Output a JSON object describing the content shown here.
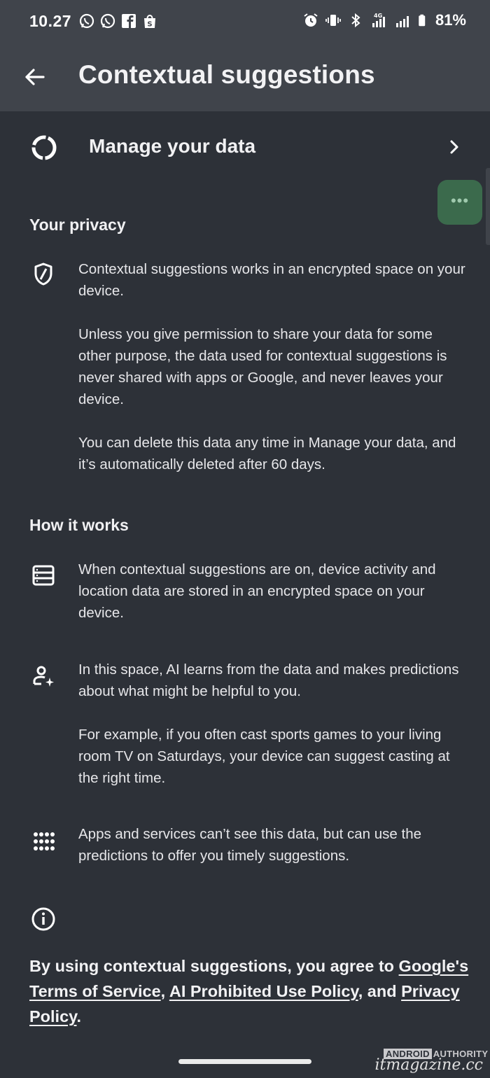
{
  "status_bar": {
    "time": "10.27",
    "battery": "81%",
    "notification_icons": [
      "whatsapp-icon",
      "whatsapp-icon",
      "facebook-icon",
      "shopee-icon"
    ],
    "system_icons": [
      "alarm-icon",
      "vibrate-icon",
      "bluetooth-icon",
      "signal-4g-icon",
      "signal-icon",
      "battery-icon"
    ]
  },
  "app_bar": {
    "title": "Contextual suggestions"
  },
  "manage": {
    "label": "Manage your data"
  },
  "privacy": {
    "heading": "Your privacy",
    "paragraphs": [
      "Contextual suggestions works in an encrypted space on your device.",
      "Unless you give permission to share your data for some other purpose, the data used for contextual suggestions is never shared with apps or Google, and never leaves your device.",
      "You can delete this data any time in Manage your data, and it’s automatically deleted after 60 days."
    ]
  },
  "how": {
    "heading": "How it works",
    "items": [
      {
        "icon": "storage-icon",
        "paragraphs": [
          "When contextual suggestions are on, device activity and location data are stored in an encrypted space on your device."
        ]
      },
      {
        "icon": "person-sparkle-icon",
        "paragraphs": [
          "In this space, AI learns from the data and makes predictions about what might be helpful to you.",
          "For example, if you often cast sports games to your living room TV on Saturdays, your device can suggest casting at the right time."
        ]
      },
      {
        "icon": "apps-grid-icon",
        "paragraphs": [
          "Apps and services can’t see this data, but can use the predictions to offer you timely suggestions."
        ]
      }
    ]
  },
  "footer": {
    "prefix": "By using contextual suggestions, you agree to ",
    "link1": "Google's Terms of Service",
    "sep1": ", ",
    "link2": "AI Prohibited Use Policy",
    "sep2": ", and ",
    "link3": "Privacy Policy",
    "suffix": "."
  },
  "watermarks": {
    "brand_a": "ANDROID",
    "brand_b": "AUTHORITY",
    "site": "itmagazine.cc"
  }
}
